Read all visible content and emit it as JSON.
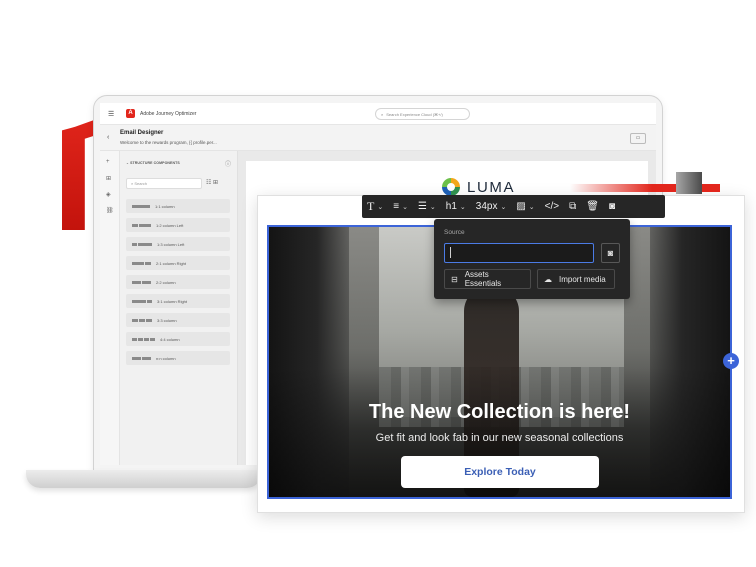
{
  "app": {
    "title": "Adobe Journey Optimizer",
    "search_placeholder": "Search Experience Cloud (⌘+/)",
    "logo_letter": "A",
    "brand_color": "#e2261c"
  },
  "designer": {
    "title": "Email Designer",
    "subtitle": "Welcome to the rewards program, {{ profile.per...",
    "preview_icon": "desktop-icon"
  },
  "panel": {
    "header": "STRUCTURE COMPONENTS",
    "search_placeholder": "Search",
    "components": [
      {
        "label": "1:1 column",
        "bars": [
          1
        ]
      },
      {
        "label": "1:2 column Left",
        "bars": [
          1,
          2
        ]
      },
      {
        "label": "1:3 column Left",
        "bars": [
          1,
          3
        ]
      },
      {
        "label": "2:1 column Right",
        "bars": [
          2,
          1
        ]
      },
      {
        "label": "2:2 column",
        "bars": [
          1,
          1
        ]
      },
      {
        "label": "3:1 column Right",
        "bars": [
          3,
          1
        ]
      },
      {
        "label": "3:3 column",
        "bars": [
          1,
          1,
          1
        ]
      },
      {
        "label": "4:4 column",
        "bars": [
          1,
          1,
          1,
          1
        ]
      },
      {
        "label": "n:n column",
        "bars": [
          1,
          1
        ]
      }
    ]
  },
  "email": {
    "brand": "LUMA",
    "headline": "The New Collection is here!",
    "subline": "Get fit and look fab in our new seasonal collections",
    "cta": "Explore Today",
    "selection_color": "#3c64d8"
  },
  "toolbar": {
    "heading": "h1",
    "font_size": "34px"
  },
  "source_popover": {
    "label": "Source",
    "value": "",
    "assets_button": "Assets Essentials",
    "import_button": "Import media"
  }
}
